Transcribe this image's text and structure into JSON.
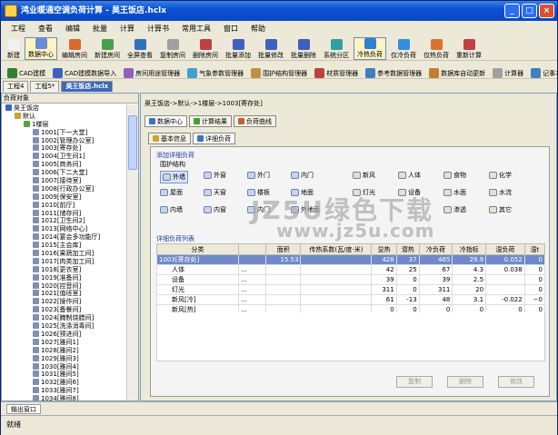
{
  "window": {
    "title": "鸿业暖通空调负荷计算 - 昊王饭店.hclx"
  },
  "menu": [
    "工程",
    "查看",
    "编辑",
    "批量",
    "计算",
    "计算书",
    "常用工具",
    "窗口",
    "帮助"
  ],
  "toolbar1": [
    {
      "label": "新建",
      "icon": "new-icon",
      "color": "#f0f0f0"
    },
    {
      "label": "数据中心",
      "icon": "data-center-icon",
      "color": "#6a8cd0",
      "pressed": true
    },
    {
      "label": "编辑房间",
      "icon": "edit-room-icon",
      "color": "#d86a30"
    },
    {
      "label": "新建房间",
      "icon": "new-room-icon",
      "color": "#4aa04a"
    },
    {
      "label": "全屏查看",
      "icon": "fullscreen-icon",
      "color": "#3070c0"
    },
    {
      "label": "复制房间",
      "icon": "copy-room-icon",
      "color": "#a0a0a0"
    },
    {
      "label": "删除房间",
      "icon": "delete-room-icon",
      "color": "#c04040"
    },
    {
      "label": "批量添加",
      "icon": "batch-add-icon",
      "color": "#4060c0"
    },
    {
      "label": "批量修改",
      "icon": "batch-edit-icon",
      "color": "#4060c0"
    },
    {
      "label": "批量删除",
      "icon": "batch-delete-icon",
      "color": "#4060c0"
    },
    {
      "label": "系统分区",
      "icon": "zone-icon",
      "color": "#30a0a0"
    },
    {
      "label": "冷热负荷",
      "icon": "cooling-heating-icon",
      "color": "#3080d0",
      "pressed": true
    },
    {
      "label": "仅冷负荷",
      "icon": "cooling-icon",
      "color": "#3090e0"
    },
    {
      "label": "仅热负荷",
      "icon": "heating-icon",
      "color": "#e07030"
    },
    {
      "label": "重新计算",
      "icon": "recalc-icon",
      "color": "#c04040"
    }
  ],
  "toolbar2": [
    {
      "label": "CAD建模",
      "icon": "cad-model-icon",
      "color": "#308030"
    },
    {
      "label": "CAD建模数据导入",
      "icon": "cad-import-icon",
      "color": "#4060c0"
    },
    {
      "label": "房间用途管理器",
      "icon": "room-usage-icon",
      "color": "#9060c0"
    },
    {
      "label": "气象参数管理器",
      "icon": "weather-icon",
      "color": "#40a0d0"
    },
    {
      "label": "围护结构管理器",
      "icon": "envelope-icon",
      "color": "#c09040"
    },
    {
      "label": "材质管理器",
      "icon": "material-icon",
      "color": "#c04040"
    },
    {
      "label": "参考数据管理器",
      "icon": "reference-icon",
      "color": "#4080c0"
    },
    {
      "label": "数据库自动更新",
      "icon": "db-update-icon",
      "color": "#c08030"
    },
    {
      "label": "计算器",
      "icon": "calculator-icon",
      "color": "#a0a0a0"
    },
    {
      "label": "记事本",
      "icon": "notepad-icon",
      "color": "#4080c0"
    }
  ],
  "doc_tabs": [
    "工程4",
    "工程5*",
    "昊王饭店.hclx"
  ],
  "tree": {
    "title": "负荷对象",
    "rows": [
      {
        "t": "昊王饭店",
        "lvl": 0,
        "c": "#3c68b4"
      },
      {
        "t": "默认",
        "lvl": 1,
        "c": "#d0a030"
      },
      {
        "t": "1楼层",
        "lvl": 2,
        "c": "#60a040"
      },
      {
        "t": "1001[下一大堂]",
        "lvl": 3,
        "c": "#8090b0"
      },
      {
        "t": "1002[管理办公室]",
        "lvl": 3,
        "c": "#8090b0"
      },
      {
        "t": "1003[寄存处]",
        "lvl": 3,
        "c": "#8090b0"
      },
      {
        "t": "1004[卫生间1]",
        "lvl": 3,
        "c": "#8090b0"
      },
      {
        "t": "1005[商务间]",
        "lvl": 3,
        "c": "#8090b0"
      },
      {
        "t": "1006[下二大堂]",
        "lvl": 3,
        "c": "#8090b0"
      },
      {
        "t": "1007[接待室]",
        "lvl": 3,
        "c": "#8090b0"
      },
      {
        "t": "1008[行政办公室]",
        "lvl": 3,
        "c": "#8090b0"
      },
      {
        "t": "1009[保安室]",
        "lvl": 3,
        "c": "#8090b0"
      },
      {
        "t": "1010[前厅]",
        "lvl": 3,
        "c": "#8090b0"
      },
      {
        "t": "1011[储存间]",
        "lvl": 3,
        "c": "#8090b0"
      },
      {
        "t": "1012[卫生间2]",
        "lvl": 3,
        "c": "#8090b0"
      },
      {
        "t": "1013[网络中心]",
        "lvl": 3,
        "c": "#8090b0"
      },
      {
        "t": "1014[宴会多功能厅]",
        "lvl": 3,
        "c": "#8090b0"
      },
      {
        "t": "1015[主会库]",
        "lvl": 3,
        "c": "#8090b0"
      },
      {
        "t": "1016[果蔬加工间]",
        "lvl": 3,
        "c": "#8090b0"
      },
      {
        "t": "1017[肉类加工间]",
        "lvl": 3,
        "c": "#8090b0"
      },
      {
        "t": "1018[更衣室]",
        "lvl": 3,
        "c": "#8090b0"
      },
      {
        "t": "1019[准备间]",
        "lvl": 3,
        "c": "#8090b0"
      },
      {
        "t": "1020[控音间]",
        "lvl": 3,
        "c": "#8090b0"
      },
      {
        "t": "1021[值班室]",
        "lvl": 3,
        "c": "#8090b0"
      },
      {
        "t": "1022[操作间]",
        "lvl": 3,
        "c": "#8090b0"
      },
      {
        "t": "1023[备餐间]",
        "lvl": 3,
        "c": "#8090b0"
      },
      {
        "t": "1024[腌制烧腊间]",
        "lvl": 3,
        "c": "#8090b0"
      },
      {
        "t": "1025[洗涤消毒间]",
        "lvl": 3,
        "c": "#8090b0"
      },
      {
        "t": "1026[预进间]",
        "lvl": 3,
        "c": "#8090b0"
      },
      {
        "t": "1027[雅间1]",
        "lvl": 3,
        "c": "#8090b0"
      },
      {
        "t": "1028[雅间2]",
        "lvl": 3,
        "c": "#8090b0"
      },
      {
        "t": "1029[雅间3]",
        "lvl": 3,
        "c": "#8090b0"
      },
      {
        "t": "1030[雅间4]",
        "lvl": 3,
        "c": "#8090b0"
      },
      {
        "t": "1031[雅间5]",
        "lvl": 3,
        "c": "#8090b0"
      },
      {
        "t": "1032[雅间6]",
        "lvl": 3,
        "c": "#8090b0"
      },
      {
        "t": "1033[雅间7]",
        "lvl": 3,
        "c": "#8090b0"
      },
      {
        "t": "1034[雅间8]",
        "lvl": 3,
        "c": "#8090b0"
      }
    ]
  },
  "breadcrumb": "昊王饭店->默认->1楼层->1003[寄存处]",
  "top_tabs": [
    "数据中心",
    "计算结果",
    "负荷曲线"
  ],
  "inner_tabs": [
    "基本信息",
    "详细负荷"
  ],
  "add_section": {
    "title": "添加详细负荷",
    "sub": "围护结构"
  },
  "components": [
    {
      "label": "外墙",
      "icon": "exterior-wall-icon",
      "pressed": true
    },
    {
      "label": "外窗",
      "icon": "exterior-window-icon"
    },
    {
      "label": "外门",
      "icon": "exterior-door-icon"
    },
    {
      "label": "内门",
      "icon": "interior-door-icon"
    },
    {
      "label": "屋面",
      "icon": "roof-icon"
    },
    {
      "label": "天窗",
      "icon": "skylight-icon"
    },
    {
      "label": "楼板",
      "icon": "floor-slab-icon"
    },
    {
      "label": "地面",
      "icon": "ground-icon"
    },
    {
      "label": "内墙",
      "icon": "interior-wall-icon"
    },
    {
      "label": "内窗",
      "icon": "interior-window-icon"
    },
    {
      "label": "内门",
      "icon": "interior-door-icon"
    },
    {
      "label": "外地面",
      "icon": "exterior-ground-icon"
    },
    {
      "label": "新风",
      "icon": "fresh-air-icon"
    },
    {
      "label": "人体",
      "icon": "people-icon"
    },
    {
      "label": "食物",
      "icon": "food-icon"
    },
    {
      "label": "化学",
      "icon": "chemical-icon"
    },
    {
      "label": "灯光",
      "icon": "lighting-icon"
    },
    {
      "label": "设备",
      "icon": "equipment-icon"
    },
    {
      "label": "水面",
      "icon": "water-surface-icon"
    },
    {
      "label": "水流",
      "icon": "water-flow-icon"
    },
    {
      "label": "渗透",
      "icon": "infiltration-icon"
    },
    {
      "label": "其它",
      "icon": "other-icon"
    }
  ],
  "list_title": "详细负荷列表",
  "columns": [
    "分类",
    "",
    "面积",
    "传热系数(瓦/度·米)",
    "显热",
    "潜热",
    "冷负荷",
    "冷指标",
    "湿负荷",
    "湿t"
  ],
  "rows": [
    {
      "name": "1003[寄存处]",
      "dots": "",
      "area": "15.53",
      "k": "",
      "sens": "428",
      "lat": "37",
      "cool": "465",
      "idx": "29.9",
      "wet": "0.052",
      "x": "0",
      "sel": true
    },
    {
      "name": "人体",
      "dots": "…",
      "area": "",
      "k": "",
      "sens": "42",
      "lat": "25",
      "cool": "67",
      "idx": "4.3",
      "wet": "0.038",
      "x": "0"
    },
    {
      "name": "设备",
      "dots": "…",
      "area": "",
      "k": "",
      "sens": "39",
      "lat": "0",
      "cool": "39",
      "idx": "2.5",
      "wet": "",
      "x": "0"
    },
    {
      "name": "灯光",
      "dots": "…",
      "area": "",
      "k": "",
      "sens": "311",
      "lat": "0",
      "cool": "311",
      "idx": "20",
      "wet": "",
      "x": "0"
    },
    {
      "name": "新风[冷]",
      "dots": "…",
      "area": "",
      "k": "",
      "sens": "61",
      "lat": "-13",
      "cool": "48",
      "idx": "3.1",
      "wet": "-0.022",
      "x": "−0"
    },
    {
      "name": "新风[热]",
      "dots": "…",
      "area": "",
      "k": "",
      "sens": "0",
      "lat": "0",
      "cool": "0",
      "idx": "0",
      "wet": "0",
      "x": "0"
    }
  ],
  "actions": [
    "复制",
    "删除",
    "修改"
  ],
  "output_tab": "输出窗口",
  "status": "就绪",
  "watermark": {
    "line1": "JZ5U绿色下载",
    "line2": "www.jz5u.com"
  }
}
